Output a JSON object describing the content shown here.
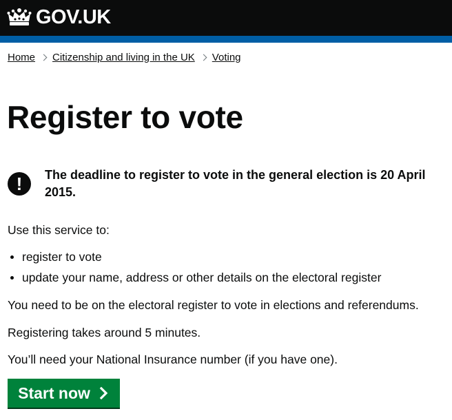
{
  "header": {
    "logo_text": "GOV.UK",
    "logo_icon": "crown-icon",
    "bg_color": "#0b0c0c",
    "bar_color": "#005ea5"
  },
  "breadcrumb": {
    "items": [
      "Home",
      "Citizenship and living in the UK",
      "Voting"
    ]
  },
  "main": {
    "title": "Register to vote",
    "warning": {
      "icon": "exclamation-icon",
      "text": "The deadline to register to vote in the general election is 20 April 2015."
    },
    "intro": "Use this service to:",
    "bullets": [
      "register to vote",
      "update your name, address or other details on the electoral register"
    ],
    "paragraphs": [
      "You need to be on the electoral register to vote in elections and referendums.",
      "Registering takes around 5 minutes.",
      "You’ll need your National Insurance number (if you have one)."
    ],
    "start_button": {
      "label": "Start now",
      "icon": "chevron-right-icon",
      "color": "#00823b"
    }
  }
}
